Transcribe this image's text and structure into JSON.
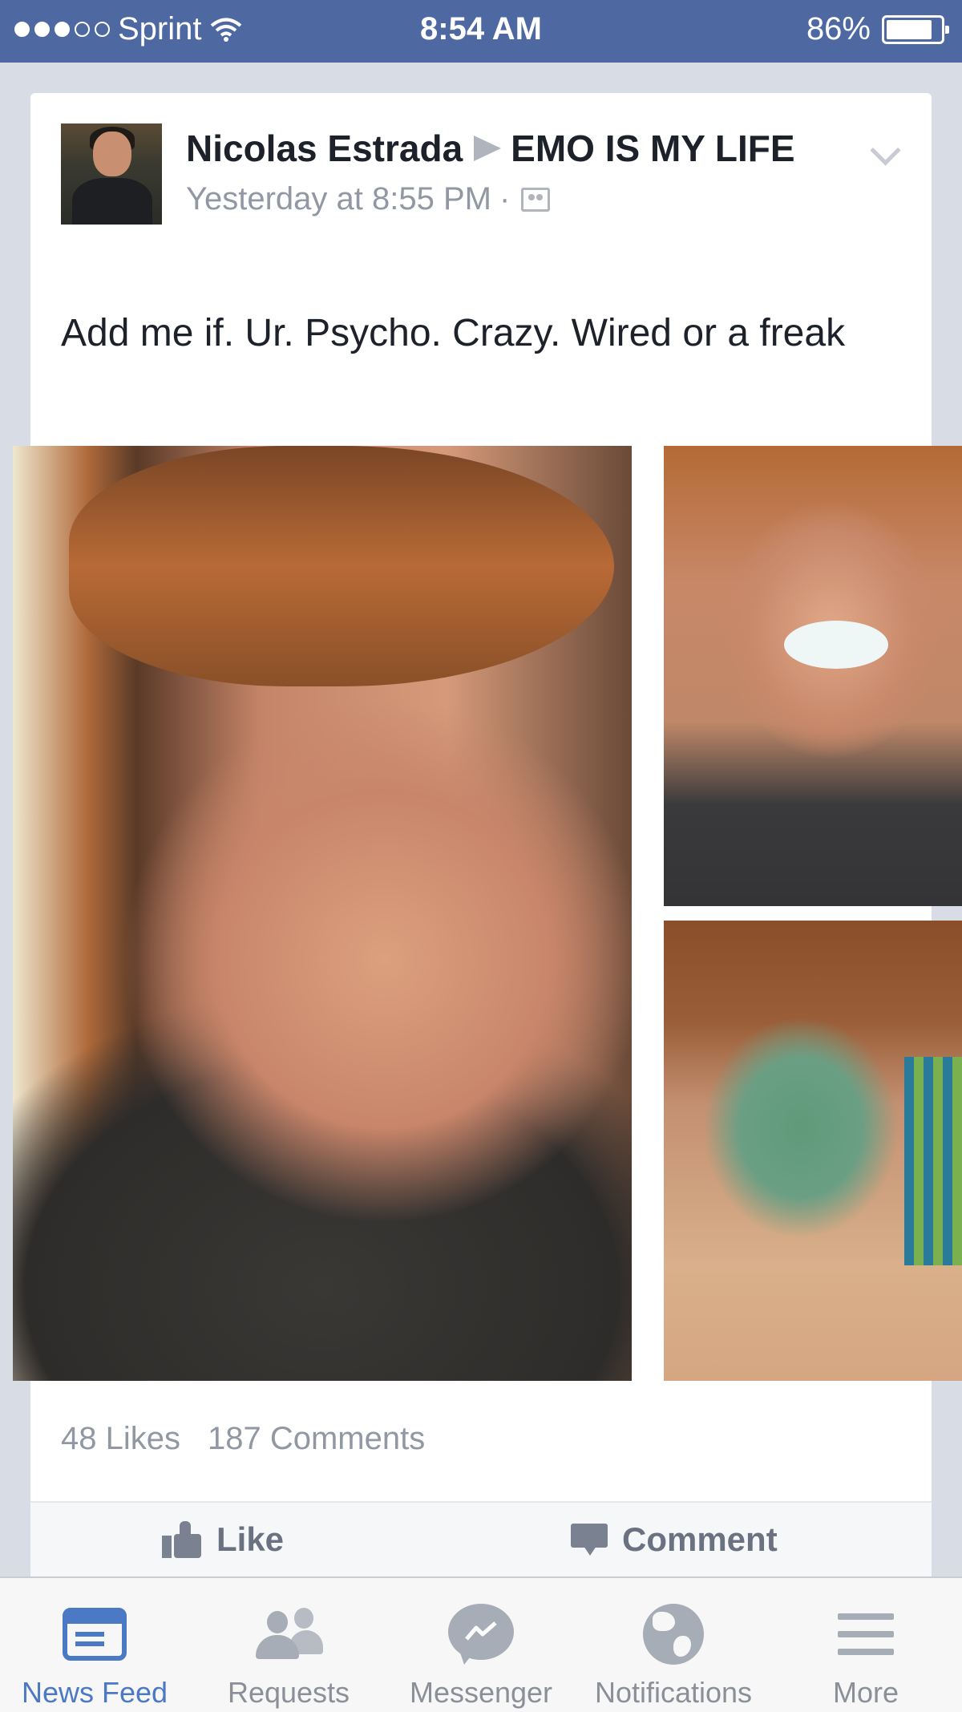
{
  "status_bar": {
    "carrier": "Sprint",
    "time": "8:54 AM",
    "battery_percent": "86%",
    "battery_level": 0.86,
    "signal_bars_filled": 3,
    "signal_bars_total": 5
  },
  "post": {
    "author": "Nicolas Estrada",
    "group": "EMO IS MY LIFE",
    "timestamp": "Yesterday at 8:55 PM",
    "separator": "·",
    "text": "Add me if.  Ur. Psycho. Crazy.  Wired  or a freak",
    "stats": {
      "likes": "48 Likes",
      "comments": "187 Comments"
    },
    "actions": {
      "like": "Like",
      "comment": "Comment"
    }
  },
  "tab_bar": {
    "tabs": [
      {
        "label": "News Feed",
        "icon": "news-feed-icon",
        "active": true
      },
      {
        "label": "Requests",
        "icon": "friend-requests-icon",
        "active": false
      },
      {
        "label": "Messenger",
        "icon": "messenger-icon",
        "active": false
      },
      {
        "label": "Notifications",
        "icon": "globe-icon",
        "active": false
      },
      {
        "label": "More",
        "icon": "menu-icon",
        "active": false
      }
    ]
  },
  "colors": {
    "brand_blue": "#4e69a2",
    "active_tab": "#4b79c4",
    "muted_text": "#9197a3"
  }
}
